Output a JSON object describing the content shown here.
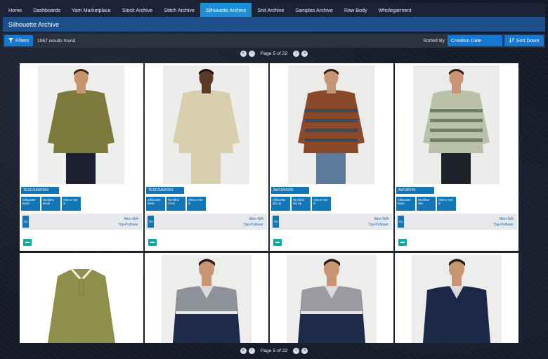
{
  "nav": {
    "items": [
      {
        "label": "Home",
        "active": false
      },
      {
        "label": "Dashboards",
        "active": false
      },
      {
        "label": "Yarn Marketplace",
        "active": false
      },
      {
        "label": "Stock Archive",
        "active": false
      },
      {
        "label": "Stitch Archive",
        "active": false
      },
      {
        "label": "Silhouette Archive",
        "active": true
      },
      {
        "label": "Snit Archive",
        "active": false
      },
      {
        "label": "Samples Archive",
        "active": false
      },
      {
        "label": "Raw Body",
        "active": false
      },
      {
        "label": "Wholegarment",
        "active": false
      }
    ]
  },
  "page": {
    "title": "Silhouette Archive"
  },
  "toolbar": {
    "filters_label": "Filters",
    "results_text": "1067 results found",
    "sorted_by_label": "Sorted By",
    "sort_value": "Creation Date",
    "sort_direction_label": "Sort Down"
  },
  "pagination": {
    "text": "Page 5 of 22"
  },
  "colors": {
    "accent": "#1479d2",
    "tag": "#1276b6",
    "nav_bg": "#1b2436",
    "title_bg": "#1f4f8a"
  },
  "cards": [
    {
      "code": "TESCOAW2004",
      "chips": [
        "Silhouette Basic",
        "Neckline Mock",
        "Sleeve Set-in"
      ],
      "badge": "7G",
      "meta_line1": "Men N/A",
      "meta_line2": "Top-Pullover",
      "photo": {
        "bg": "#eeeeec",
        "garment": "#7c7a3a",
        "pants": "#1c2030",
        "skin": "#c9936b",
        "hair": "#3a2618",
        "stripe": ""
      }
    },
    {
      "code": "TESCOAW2001",
      "chips": [
        "Silhouette Basic",
        "Neckline Crew",
        "Sleeve Set-in"
      ],
      "badge": "7G",
      "meta_line1": "Men N/A",
      "meta_line2": "Top-Pullover",
      "photo": {
        "bg": "#ececea",
        "garment": "#d8cfae",
        "pants": "#d8cfae",
        "skin": "#5a3a26",
        "hair": "#1a1008",
        "stripe": ""
      }
    },
    {
      "code": "AW19/40245",
      "chips": [
        "Silhouette Zip Up",
        "Neckline Zip Up",
        "Sleeve Set-in"
      ],
      "badge": "7G",
      "meta_line1": "Men N/A",
      "meta_line2": "Top-Pullover",
      "photo": {
        "bg": "#ebebea",
        "garment": "#8a4a2a",
        "pants": "#5c7a9c",
        "skin": "#c79573",
        "hair": "#2b1d14",
        "stripe": "#3e4a5c"
      }
    },
    {
      "code": "AW190744",
      "chips": [
        "Silhouette Basic",
        "Neckline Vee",
        "Sleeve Set-in"
      ],
      "badge": "7G",
      "meta_line1": "Men N/A",
      "meta_line2": "Top-Pullover",
      "photo": {
        "bg": "#ebebea",
        "garment": "#b9c2a8",
        "pants": "#1f2228",
        "skin": "#c99473",
        "hair": "#2a1c14",
        "stripe": "#6e8066"
      }
    },
    {
      "photo": {
        "bg": "#ffffff",
        "garment": "#8f8f4c",
        "pants": "#8f8f4c",
        "skin": "#ffffff",
        "hair": "#ffffff",
        "stripe": "#f2efe2"
      }
    },
    {
      "photo": {
        "bg": "#ededeb",
        "garment": "#8e9197",
        "pants": "#1e2a4a",
        "skin": "#c89573",
        "hair": "#2a1d14",
        "stripe": "#e6e6e6"
      }
    },
    {
      "photo": {
        "bg": "#ededeb",
        "garment": "#9a9ca2",
        "pants": "#1e2a4a",
        "skin": "#c89573",
        "hair": "#2a1d14",
        "stripe": "#e6e6e6"
      }
    },
    {
      "photo": {
        "bg": "#ededeb",
        "garment": "#1c2848",
        "pants": "#1c2848",
        "skin": "#c89573",
        "hair": "#2a1d14",
        "stripe": "#1c2848"
      }
    }
  ]
}
